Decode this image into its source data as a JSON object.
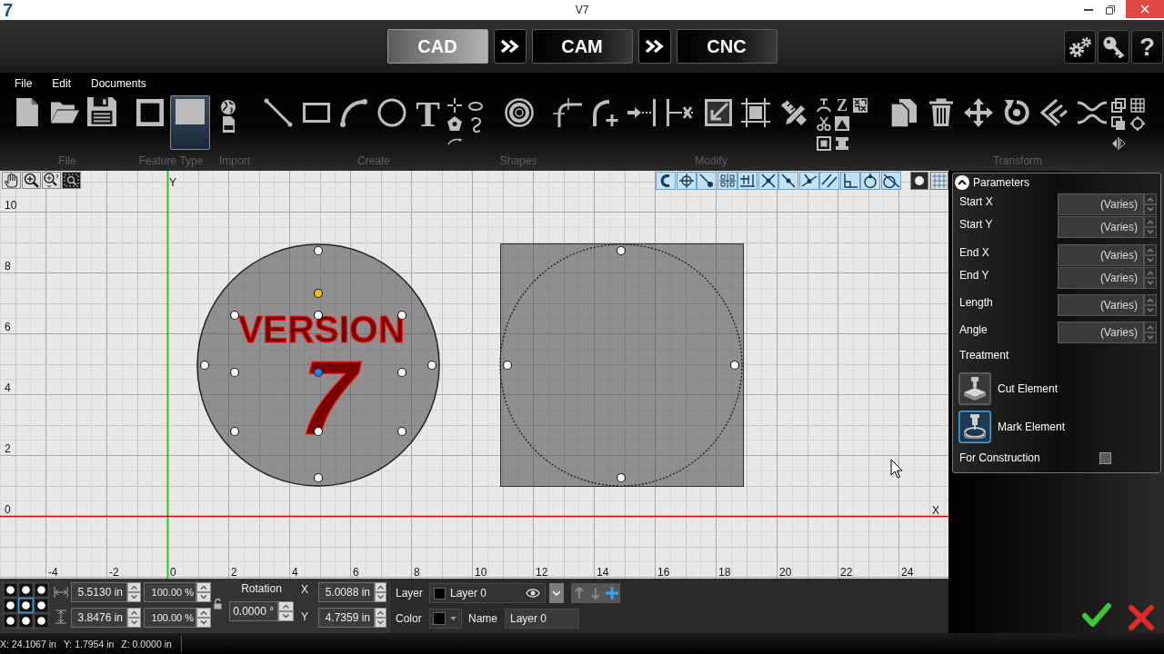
{
  "title_bar": {
    "logo": "7",
    "title": "V7"
  },
  "mode_bar": {
    "tabs": [
      {
        "label": "CAD",
        "selected": true
      },
      {
        "label": "CAM",
        "selected": false
      },
      {
        "label": "CNC",
        "selected": false
      }
    ],
    "help": "?"
  },
  "ribbon": {
    "menu": [
      "File",
      "Edit",
      "Documents"
    ],
    "groups": [
      {
        "label": "File"
      },
      {
        "label": "Feature Type",
        "buttons": [
          {
            "selected": false
          },
          {
            "selected": true
          }
        ]
      },
      {
        "label": "Import"
      },
      {
        "label": "Create",
        "tool_glyph": "T"
      },
      {
        "label": "Shapes"
      },
      {
        "label": "Modify",
        "tool_glyph": "Z"
      },
      {
        "label": "Transform"
      }
    ]
  },
  "canvas": {
    "zoom_tools": [
      {
        "selected": false
      },
      {
        "selected": false
      },
      {
        "selected": false
      },
      {
        "selected": true
      }
    ],
    "snap_tools": [
      {
        "on": true
      },
      {
        "on": true
      },
      {
        "on": true
      },
      {
        "on": true
      },
      {
        "on": true
      },
      {
        "on": true
      },
      {
        "on": true
      },
      {
        "on": true
      },
      {
        "on": true
      },
      {
        "on": true
      },
      {
        "on": true
      },
      {
        "on": true
      }
    ],
    "view_toggles": [
      {
        "on": true
      },
      {
        "on": false
      }
    ],
    "x_axis_label": "X",
    "y_axis_label": "Y",
    "x_ticks": [
      "-4",
      "-2",
      "0",
      "2",
      "4",
      "6",
      "8",
      "10",
      "12",
      "14",
      "16",
      "18",
      "20",
      "22",
      "24"
    ],
    "y_ticks": [
      "10",
      "8",
      "6",
      "4",
      "2",
      "0"
    ],
    "objects": [
      {
        "kind": "disc",
        "selected": true
      },
      {
        "kind": "engraving",
        "texts": [
          "VERSION",
          "7"
        ],
        "selected": true
      },
      {
        "kind": "plate",
        "selected": true
      }
    ]
  },
  "parameters": {
    "title": "Parameters",
    "fields": [
      {
        "label": "Start X",
        "value": "(Varies)"
      },
      {
        "label": "Start Y",
        "value": "(Varies)"
      },
      {
        "label": "End X",
        "value": "(Varies)"
      },
      {
        "label": "End Y",
        "value": "(Varies)"
      },
      {
        "label": "Length",
        "value": "(Varies)"
      },
      {
        "label": "Angle",
        "value": "(Varies)"
      }
    ],
    "treatment_label": "Treatment",
    "treatments": [
      {
        "label": "Cut Element",
        "selected": false
      },
      {
        "label": "Mark Element",
        "selected": true
      }
    ],
    "for_construction": {
      "label": "For Construction",
      "checked": false
    }
  },
  "transform_bar": {
    "anchor": [
      {
        "selected": false
      },
      {
        "selected": false
      },
      {
        "selected": false
      },
      {
        "selected": false
      },
      {
        "selected": true
      },
      {
        "selected": false
      },
      {
        "selected": false
      },
      {
        "selected": false
      },
      {
        "selected": false
      }
    ],
    "width": "5.5130 in",
    "width_scale": "100.00 %",
    "height": "3.8476 in",
    "height_scale": "100.00 %",
    "rotation_label": "Rotation",
    "rotation": "0.0000 °",
    "x_label": "X",
    "x": "5.0088 in",
    "y_label": "Y",
    "y": "4.7359 in"
  },
  "layer_bar": {
    "layer_label": "Layer",
    "layer": "Layer 0",
    "layer_buttons": [
      {
        "kind": "up",
        "disabled": true
      },
      {
        "kind": "down",
        "disabled": true
      },
      {
        "kind": "add",
        "disabled": false
      }
    ],
    "color_label": "Color",
    "name_label": "Name",
    "name": "Layer 0"
  },
  "status_bar": [
    "X: 24.1067 in",
    "Y: 1.7954 in",
    "Z: 0.0000 in"
  ]
}
